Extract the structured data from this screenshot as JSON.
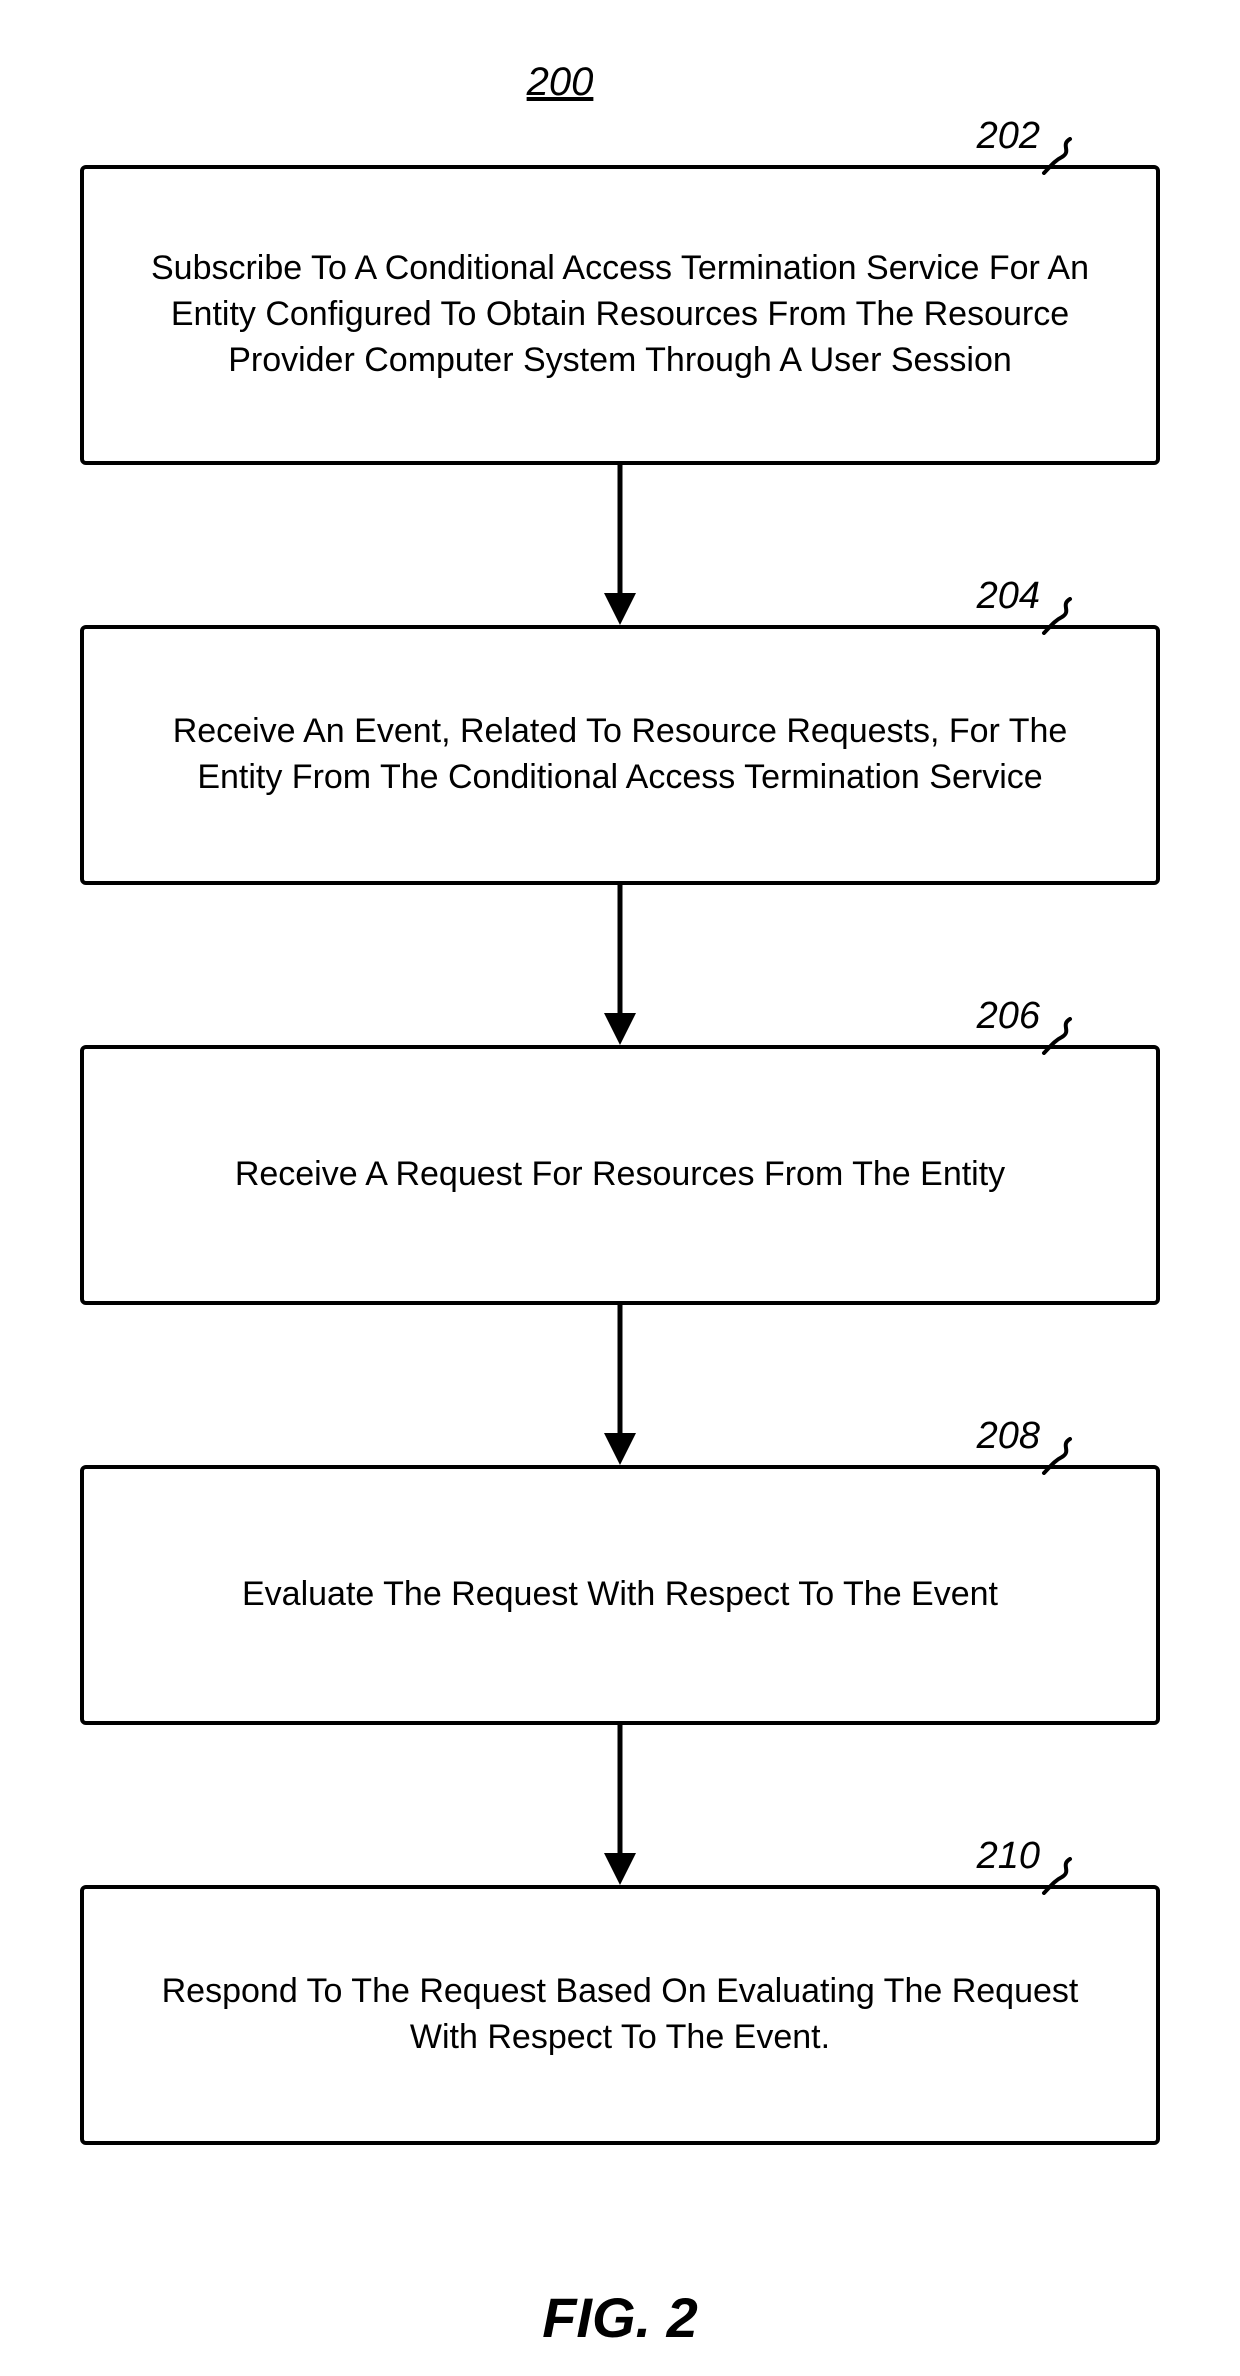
{
  "diagram_id": "200",
  "steps": [
    {
      "ref": "202",
      "text": "Subscribe To A Conditional Access Termination Service For An Entity Configured To Obtain Resources From The Resource Provider Computer System Through A User Session"
    },
    {
      "ref": "204",
      "text": "Receive An Event, Related To Resource Requests, For The Entity From The Conditional Access Termination Service"
    },
    {
      "ref": "206",
      "text": "Receive A Request For Resources From The Entity"
    },
    {
      "ref": "208",
      "text": "Evaluate The Request With Respect To The Event"
    },
    {
      "ref": "210",
      "text": "Respond To The Request Based On Evaluating The Request With Respect To The Event."
    }
  ],
  "figure_caption": "FIG. 2"
}
